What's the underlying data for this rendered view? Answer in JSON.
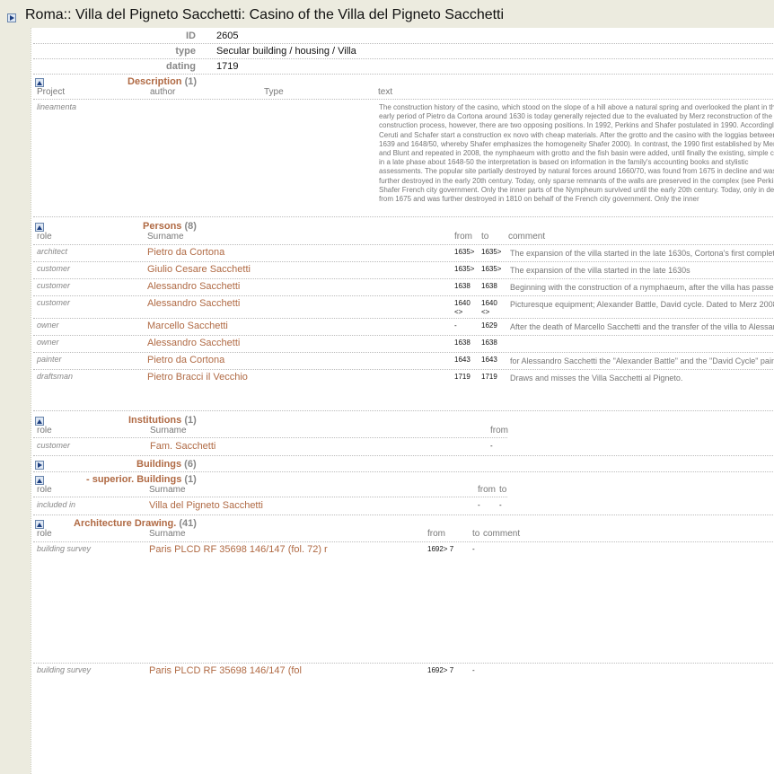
{
  "title": "Roma:: Villa del Pigneto Sacchetti: Casino of the Villa del Pigneto Sacchetti",
  "fields": [
    {
      "label": "ID",
      "value": "2605"
    },
    {
      "label": "type",
      "value": "Secular building / housing / Villa"
    },
    {
      "label": "dating",
      "value": "1719"
    }
  ],
  "description": {
    "title": "Description",
    "count": "(1)",
    "headers": {
      "project": "Project",
      "author": "author",
      "type": "Type",
      "text": "text"
    },
    "project": "lineamenta",
    "text": "The construction history of the casino, which stood on the slope of a hill above a natural spring and overlooked the plant in the early period of Pietro da Cortona around 1630 is today generally rejected due to the evaluated by Merz reconstruction of the construction process, however, there are two opposing positions. In 1992, Perkins and Shafer postulated in 1990. Accordingly, Ceruti and Schafer start a construction ex novo with cheap materials. After the grotto and the casino with the loggias between 1639 and 1648/50, whereby Shafer emphasizes the homogeneity Shafer 2000). In contrast, the 1990 first established by Merz and Blunt and repeated in 2008, the nymphaeum with grotto and the fish basin were added, until finally the existing, simple casino in a late phase about 1648-50 the interpretation is based on information in the family's accounting books and stylistic assessments. The popular site partially destroyed by natural forces around 1660/70, was found from 1675 in decline and was further destroyed in the early 20th century. Today, only sparse remnants of the walls are preserved in the complex (see Perkins / Shafer French city government. Only the inner parts of the Nympheum survived until the early 20th century. Today, only in decay from 1675 and was further destroyed in 1810 on behalf of the French city government. Only the inner"
  },
  "persons": {
    "title": "Persons",
    "count": "(8)",
    "headers": {
      "role": "role",
      "surname": "Surname",
      "from": "from",
      "to": "to",
      "comment": "comment"
    },
    "rows": [
      {
        "role": "architect",
        "name": "Pietro da Cortona",
        "from": "1635>",
        "to": "1635>",
        "comment": "The expansion of the villa started in the late 1630s, Cortona's first complete"
      },
      {
        "role": "customer",
        "name": "Giulio Cesare Sacchetti",
        "from": "1635>",
        "to": "1635>",
        "comment": "The expansion of the villa started in the late 1630s"
      },
      {
        "role": "customer",
        "name": "Alessandro Sacchetti",
        "from": "1638",
        "to": "1638",
        "comment": "Beginning with the construction of a nymphaeum, after the villa has passed"
      },
      {
        "role": "customer",
        "name": "Alessandro Sacchetti",
        "from": "1640 <>",
        "to": "1640 <>",
        "comment": "Picturesque equipment; Alexander Battle, David cycle. Dated to Merz 2008"
      },
      {
        "role": "owner",
        "name": "Marcello Sacchetti",
        "from": "-",
        "to": "1629",
        "comment": "After the death of Marcello Sacchetti and the transfer of the villa to Alessan"
      },
      {
        "role": "owner",
        "name": "Alessandro Sacchetti",
        "from": "1638",
        "to": "1638",
        "comment": ""
      },
      {
        "role": "painter",
        "name": "Pietro da Cortona",
        "from": "1643",
        "to": "1643",
        "comment": "for Alessandro Sacchetti the \"Alexander Battle\" and the \"David Cycle\" pain"
      },
      {
        "role": "draftsman",
        "name": "Pietro Bracci il Vecchio",
        "from": "1719",
        "to": "1719",
        "comment": "Draws and misses the Villa Sacchetti al Pigneto."
      }
    ]
  },
  "institutions": {
    "title": "Institutions",
    "count": "(1)",
    "headers": {
      "role": "role",
      "surname": "Surname",
      "from": "from"
    },
    "rows": [
      {
        "role": "customer",
        "name": "Fam. Sacchetti",
        "from": "-"
      }
    ]
  },
  "buildings": {
    "title": "Buildings",
    "count": "(6)"
  },
  "superior": {
    "title": "- superior. Buildings",
    "count": "(1)",
    "headers": {
      "role": "role",
      "surname": "Surname",
      "from": "from",
      "to": "to"
    },
    "rows": [
      {
        "role": "included in",
        "name": "Villa del Pigneto Sacchetti",
        "from": "-",
        "to": "-"
      }
    ]
  },
  "drawings": {
    "title": "Architecture Drawing.",
    "count": "(41)",
    "headers": {
      "role": "role",
      "surname": "Surname",
      "from": "from",
      "to": "to",
      "comment": "comment"
    },
    "rows": [
      {
        "role": "building survey",
        "name": "Paris PLCD RF 35698 146/147 (fol. 72) r",
        "from": "1692> 7",
        "to": "-"
      },
      {
        "role": "building survey",
        "name": "Paris PLCD RF 35698 146/147 (fol",
        "from": "1692> 7",
        "to": "-"
      }
    ]
  }
}
